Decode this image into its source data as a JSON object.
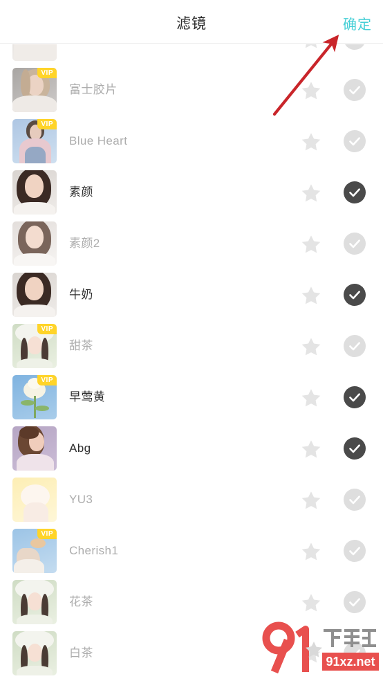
{
  "header": {
    "title": "滤镜",
    "confirm_label": "确定",
    "confirm_color": "#45cfd6",
    "title_color": "#2b2b2b"
  },
  "icons": {
    "star": "star-icon",
    "check": "check-icon",
    "arrow": "red-arrow-annotation",
    "watermark": "91xz-watermark-logo"
  },
  "colors": {
    "vip_badge_bg": "#ffd429",
    "vip_badge_text": "#ffffff",
    "check_on_bg": "#4a4a4a",
    "check_off_bg": "#dedede",
    "star_fill": "#e4e4e4",
    "label_on": "#2e2e2e",
    "label_off": "#adadad",
    "arrow_red": "#c9252a",
    "watermark_red": "#e8504e"
  },
  "list": {
    "vip_badge_label": "VIP",
    "rows": [
      {
        "name": "",
        "vip": false,
        "selected": false,
        "partial": true,
        "thumb": "portrait-pale"
      },
      {
        "name": "富士胶片",
        "vip": true,
        "selected": false,
        "thumb": "portrait-gray"
      },
      {
        "name": "Blue Heart",
        "vip": true,
        "selected": false,
        "thumb": "portrait-blue"
      },
      {
        "name": "素颜",
        "vip": false,
        "selected": true,
        "thumb": "portrait-dark"
      },
      {
        "name": "素颜2",
        "vip": false,
        "selected": false,
        "thumb": "portrait-light"
      },
      {
        "name": "牛奶",
        "vip": false,
        "selected": true,
        "thumb": "portrait-dark"
      },
      {
        "name": "甜茶",
        "vip": true,
        "selected": false,
        "thumb": "portrait-hat-green"
      },
      {
        "name": "早莺黄",
        "vip": true,
        "selected": true,
        "thumb": "flower-blue"
      },
      {
        "name": "Abg",
        "vip": false,
        "selected": true,
        "thumb": "portrait-purple"
      },
      {
        "name": "YU3",
        "vip": false,
        "selected": false,
        "thumb": "portrait-yellow"
      },
      {
        "name": "Cherish1",
        "vip": true,
        "selected": false,
        "thumb": "hand-blue"
      },
      {
        "name": "花茶",
        "vip": false,
        "selected": false,
        "thumb": "portrait-hat-green"
      },
      {
        "name": "白茶",
        "vip": false,
        "selected": false,
        "thumb": "portrait-hat-green"
      }
    ]
  },
  "watermark": {
    "number": "91",
    "chinese": "下载站",
    "domain": "91xz.net"
  }
}
